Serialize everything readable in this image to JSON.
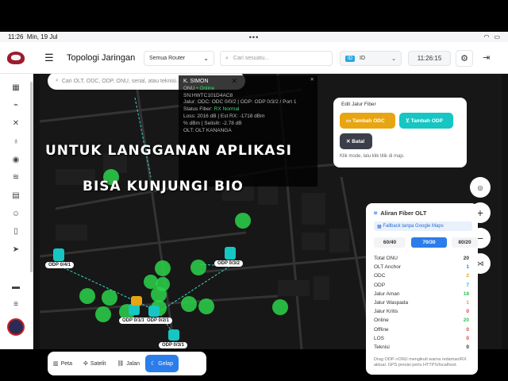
{
  "status_bar": {
    "time": "11:26",
    "date": "Min, 19 Jul",
    "battery": "■"
  },
  "app": {
    "title": "Topologi Jaringan"
  },
  "header": {
    "router_select": "Semua Router",
    "search_placeholder": "Cari sesuatu...",
    "id_badge": "ID",
    "id_value": "ID",
    "clock": "11:26:15"
  },
  "map_search": {
    "placeholder": "Cari OLT, ODC, ODP, ONU, serial, atau teknisi..."
  },
  "popup": {
    "name": "K. SIMON",
    "lines": [
      {
        "text": "ONU",
        "status": "• Online"
      },
      {
        "text": "SN:HWTC101D4AC8"
      },
      {
        "text": ""
      },
      {
        "text": "Jalur: ODC: ODC 0/0/2 | ODP: ODP 0/3/2 / Port 1"
      },
      {
        "text": "Status Fiber:",
        "status": "RX Normal"
      },
      {
        "text": "Loss: 2016 dB | Est RX: -1718 dBm"
      },
      {
        "text": "% dBm | Selisih: -2.78 dB"
      },
      {
        "text": ""
      },
      {
        "text": "OLT: OLT KANANGA"
      }
    ]
  },
  "overlay": {
    "line1": "UNTUK LANGGANAN APLIKASI",
    "line2": "BISA KUNJUNGI BIO"
  },
  "node_labels": [
    {
      "text": "ODP 0/4/1"
    },
    {
      "text": "ODP 0/3/2"
    },
    {
      "text": "ODP 0/1/1"
    },
    {
      "text": "ODP 0/2/1"
    },
    {
      "text": "ODP 0/3/1"
    }
  ],
  "edit_panel": {
    "header": "Edit Jalur Fiber",
    "tambah_odc": "Tambah ODC",
    "tambah_odp": "Tambah ODP",
    "batal": "Batal",
    "hint": "Klik mode, lalu klik titik di map."
  },
  "route_panel": {
    "title": "Aliran Fiber OLT",
    "fallback": "Fallback tanpa Google Maps",
    "tabs": [
      "60/40",
      "70/30",
      "80/20"
    ],
    "active_tab": "70/30",
    "stats": [
      {
        "label": "Total ONU",
        "value": "20",
        "color": "#333333"
      },
      {
        "label": "OLT Anchor",
        "value": "1",
        "color": "#2b7de9"
      },
      {
        "label": "ODC",
        "value": "2",
        "color": "#e8a512"
      },
      {
        "label": "ODP",
        "value": "7",
        "color": "#16c6c3"
      },
      {
        "label": "Jalur Aman",
        "value": "18",
        "color": "#2fbf5b"
      },
      {
        "label": "Jalur Waspada",
        "value": "1",
        "color": "#e8a512"
      },
      {
        "label": "Jalur Kritis",
        "value": "0",
        "color": "#e0403a"
      },
      {
        "label": "Online",
        "value": "20",
        "color": "#2fbf5b"
      },
      {
        "label": "Offline",
        "value": "0",
        "color": "#e0403a"
      },
      {
        "label": "LOS",
        "value": "0",
        "color": "#e0403a"
      },
      {
        "label": "Teknisi",
        "value": "0",
        "color": "#333333"
      }
    ],
    "footer": "Drag ODP->ONU mengikuti warna redaman/RX aktual. GPS presisi perlu HTTPS/localhost."
  },
  "bottom_tabs": [
    {
      "icon": "map-icon",
      "label": "Peta",
      "active": false
    },
    {
      "icon": "satellite-icon",
      "label": "Satelit",
      "active": false
    },
    {
      "icon": "road-icon",
      "label": "Jalan",
      "active": false
    },
    {
      "icon": "moon-icon",
      "label": "Gelap",
      "active": true
    }
  ]
}
